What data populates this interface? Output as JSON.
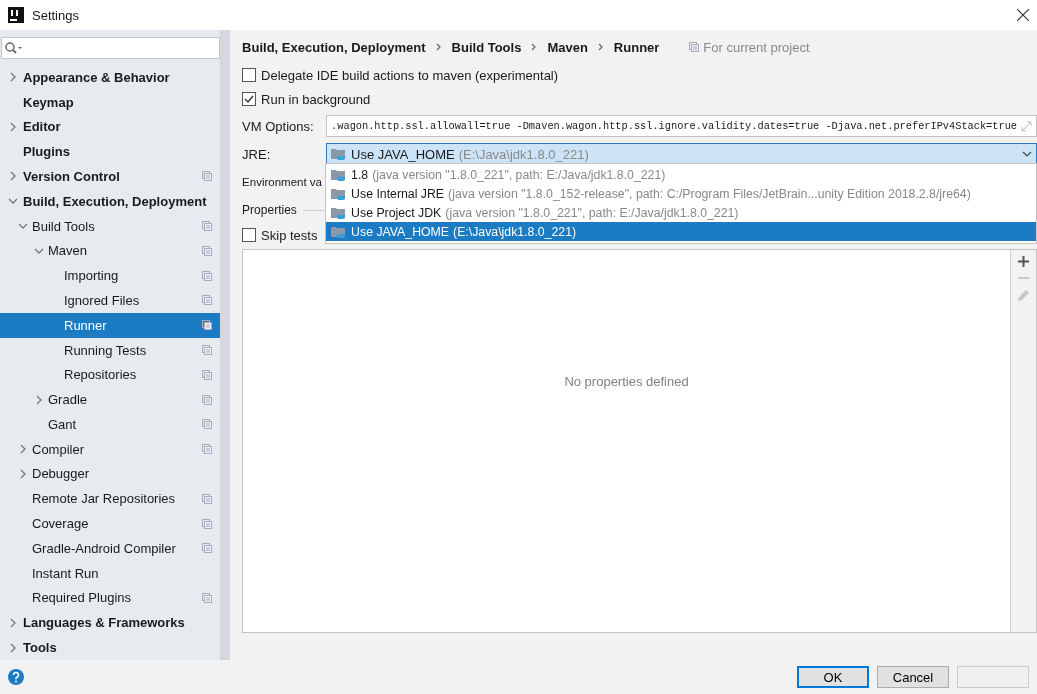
{
  "window": {
    "title": "Settings"
  },
  "sidebar": {
    "items": [
      {
        "label": "Appearance & Behavior",
        "expanded": false,
        "selected": false,
        "shared": false
      },
      {
        "label": "Keymap",
        "selected": false,
        "shared": false
      },
      {
        "label": "Editor",
        "expanded": false,
        "selected": false,
        "shared": false
      },
      {
        "label": "Plugins",
        "selected": false,
        "shared": false
      },
      {
        "label": "Version Control",
        "expanded": false,
        "selected": false,
        "shared": true
      },
      {
        "label": "Build, Execution, Deployment",
        "expanded": true,
        "selected": false,
        "shared": false,
        "children": [
          {
            "label": "Build Tools",
            "expanded": true,
            "selected": false,
            "shared": true,
            "children": [
              {
                "label": "Maven",
                "expanded": true,
                "selected": false,
                "shared": true,
                "children": [
                  {
                    "label": "Importing",
                    "selected": false,
                    "shared": true
                  },
                  {
                    "label": "Ignored Files",
                    "selected": false,
                    "shared": true
                  },
                  {
                    "label": "Runner",
                    "selected": true,
                    "shared": true
                  },
                  {
                    "label": "Running Tests",
                    "selected": false,
                    "shared": true
                  },
                  {
                    "label": "Repositories",
                    "selected": false,
                    "shared": true
                  }
                ]
              },
              {
                "label": "Gradle",
                "expanded": false,
                "selected": false,
                "shared": true
              },
              {
                "label": "Gant",
                "selected": false,
                "shared": true
              }
            ]
          },
          {
            "label": "Compiler",
            "expanded": false,
            "selected": false,
            "shared": true
          },
          {
            "label": "Debugger",
            "expanded": false,
            "selected": false,
            "shared": false
          },
          {
            "label": "Remote Jar Repositories",
            "selected": false,
            "shared": true
          },
          {
            "label": "Coverage",
            "selected": false,
            "shared": true
          },
          {
            "label": "Gradle-Android Compiler",
            "selected": false,
            "shared": true
          },
          {
            "label": "Instant Run",
            "selected": false,
            "shared": false
          },
          {
            "label": "Required Plugins",
            "selected": false,
            "shared": true
          }
        ]
      },
      {
        "label": "Languages & Frameworks",
        "expanded": false,
        "selected": false,
        "shared": false
      },
      {
        "label": "Tools",
        "expanded": false,
        "selected": false,
        "shared": false
      }
    ]
  },
  "breadcrumb": [
    "Build, Execution, Deployment",
    "Build Tools",
    "Maven",
    "Runner"
  ],
  "scope": "For current project",
  "options": [
    {
      "label": "Delegate IDE build actions to maven (experimental)",
      "checked": false
    },
    {
      "label": "Run in background",
      "checked": true
    }
  ],
  "vm_options": {
    "label": "VM Options:",
    "value": ".wagon.http.ssl.allowall=true -Dmaven.wagon.http.ssl.ignore.validity.dates=true -Djava.net.preferIPv4Stack=true"
  },
  "jre": {
    "label": "JRE:",
    "name": "Use JAVA_HOME",
    "detail": "(E:\\Java\\jdk1.8.0_221)"
  },
  "jre_options": [
    {
      "name": "1.8",
      "detail": "(java version \"1.8.0_221\", path: E:/Java/jdk1.8.0_221)",
      "selected": false
    },
    {
      "name": "Use Internal JRE",
      "detail": "(java version \"1.8.0_152-release\", path: C:/Program Files/JetBrain...unity Edition 2018.2.8/jre64)",
      "selected": false
    },
    {
      "name": "Use Project JDK",
      "detail": "(java version \"1.8.0_221\", path: E:/Java/jdk1.8.0_221)",
      "selected": false
    },
    {
      "name": "Use JAVA_HOME",
      "detail": "(E:\\Java\\jdk1.8.0_221)",
      "selected": true
    }
  ],
  "environment_label": "Environment va",
  "properties_label": "Properties",
  "skip_tests": {
    "label": "Skip tests",
    "checked": false
  },
  "properties_table": {
    "empty_text": "No properties defined",
    "tools": [
      {
        "kind": "add",
        "disabled": false
      },
      {
        "kind": "remove",
        "disabled": true
      },
      {
        "kind": "edit",
        "disabled": true
      }
    ]
  },
  "buttons": [
    {
      "label": "OK",
      "default": true
    },
    {
      "label": "Cancel",
      "default": false
    }
  ]
}
